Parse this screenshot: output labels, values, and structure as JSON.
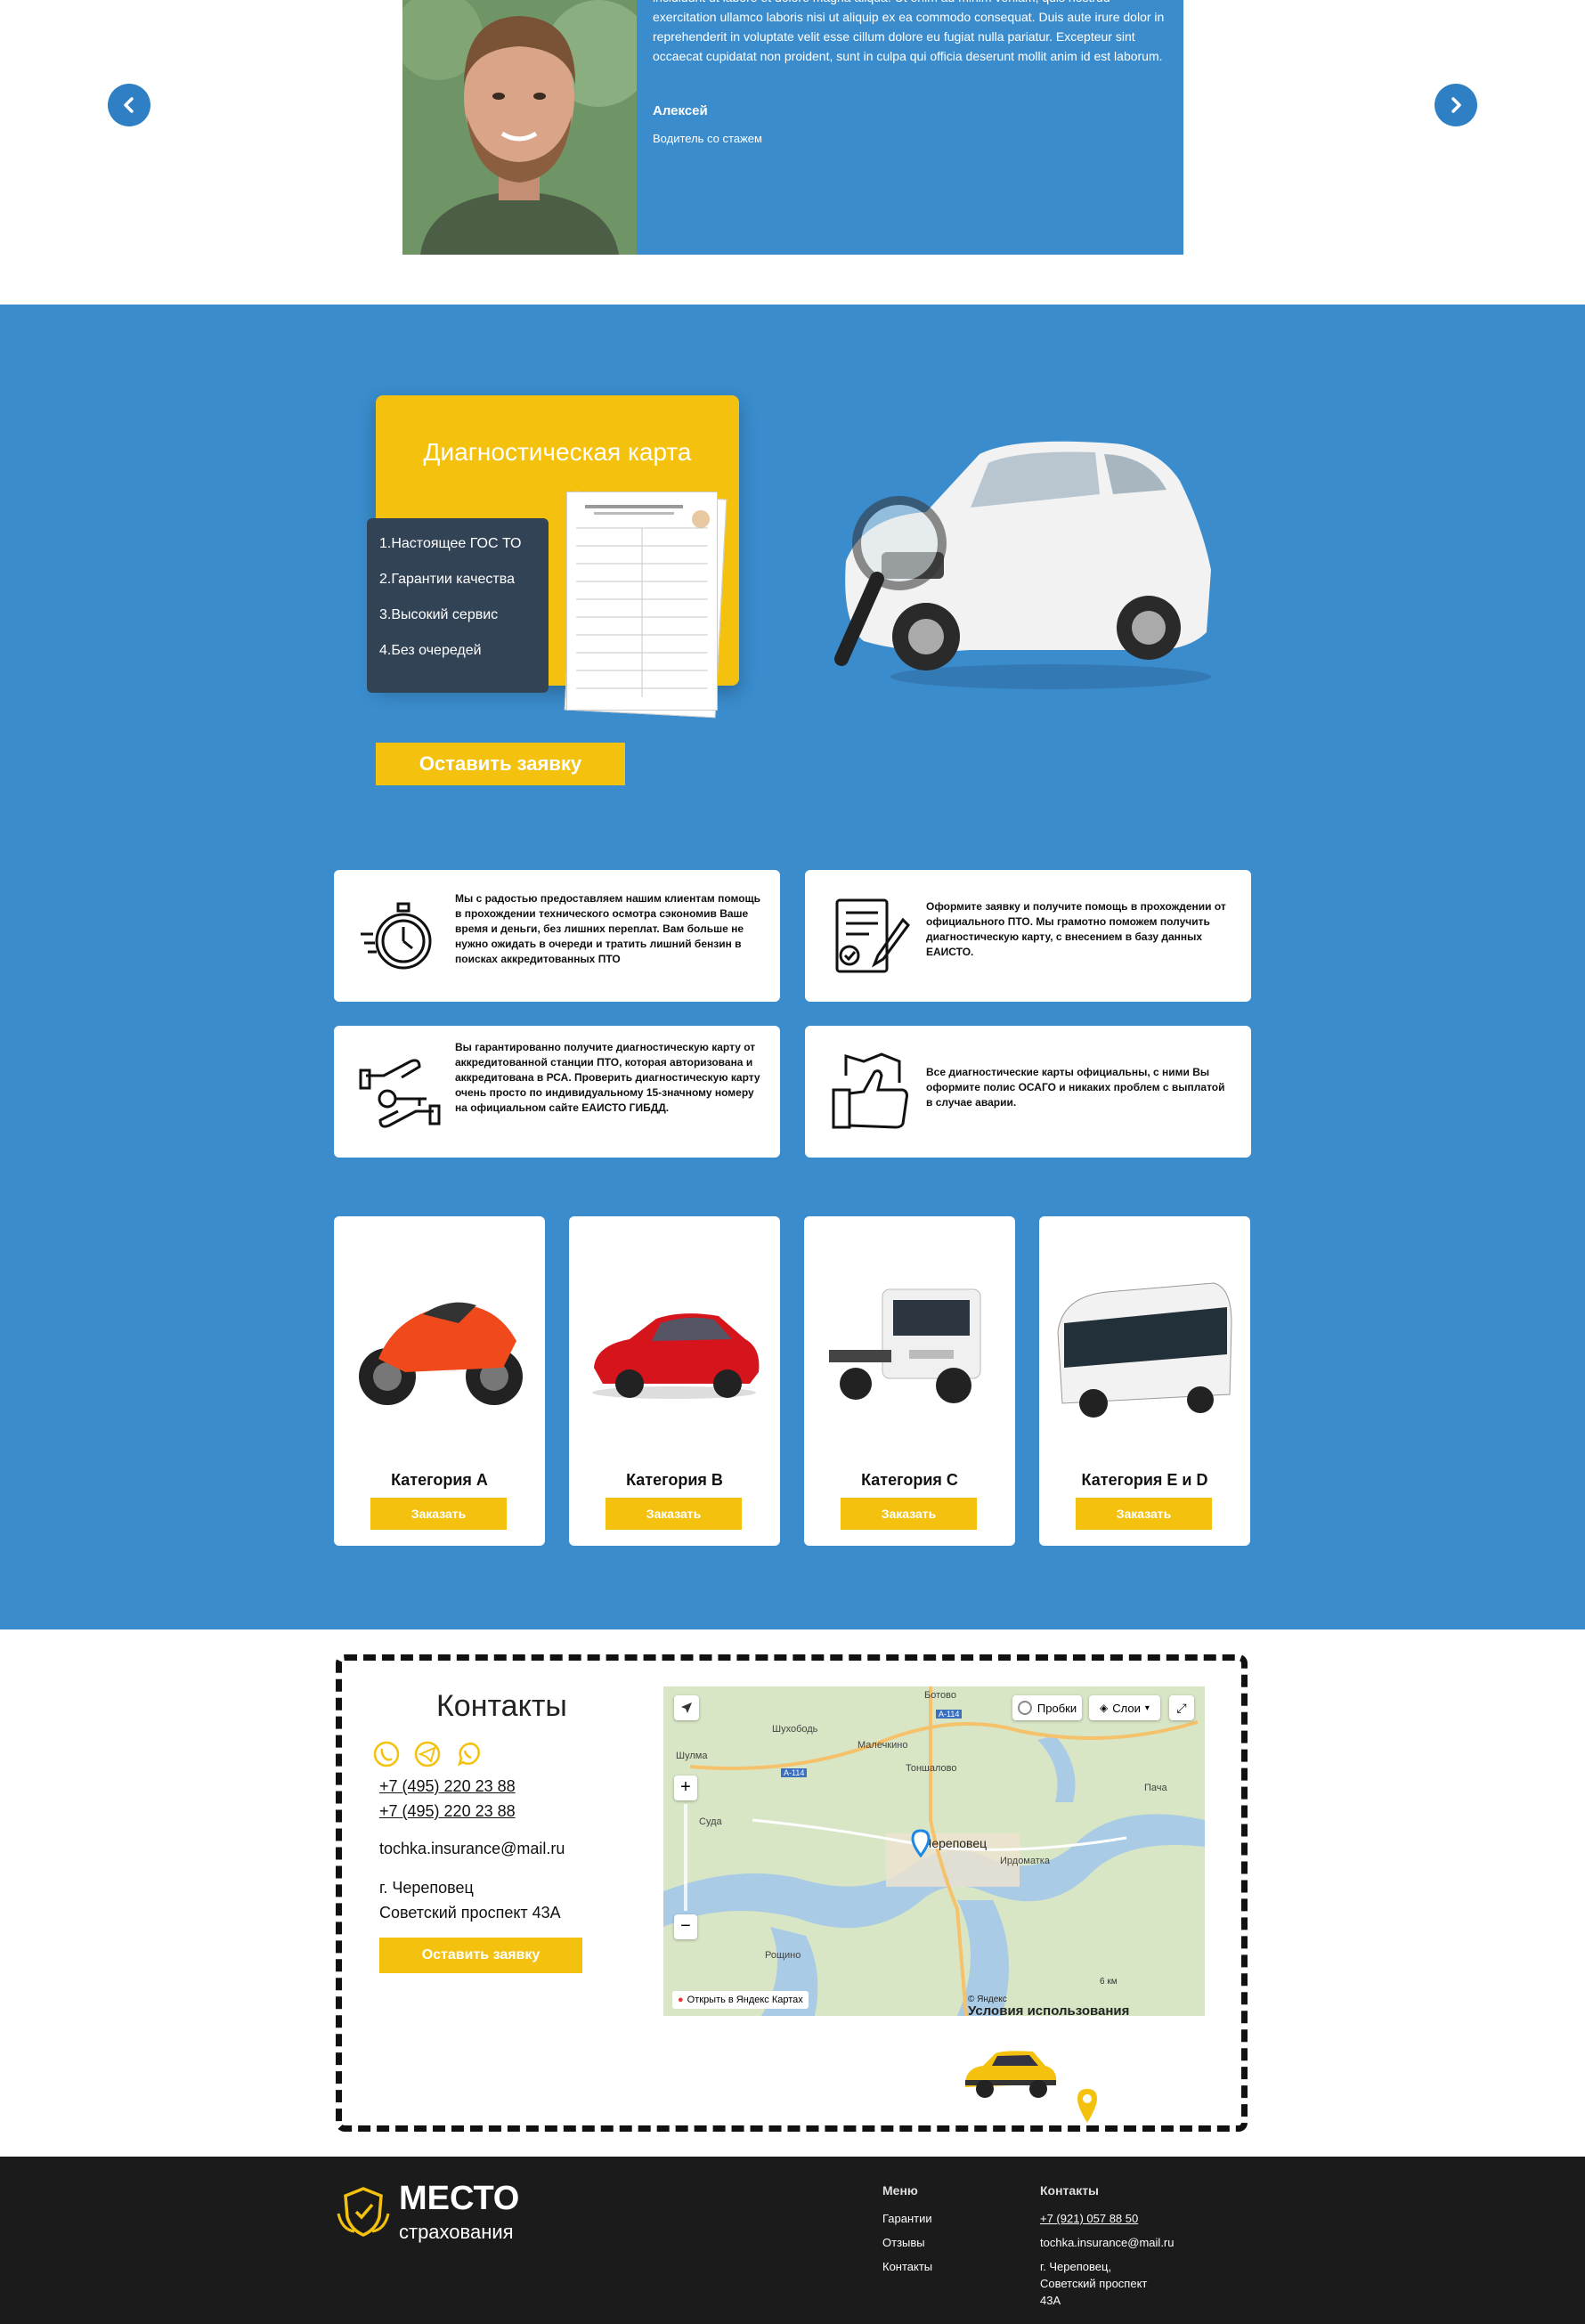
{
  "testimonial": {
    "text": "incididunt ut labore et dolore magna aliqua. Ut enim ad minim veniam, quis nostrud exercitation ullamco laboris nisi ut aliquip ex ea commodo consequat. Duis aute irure dolor in reprehenderit in voluptate velit esse cillum dolore eu fugiat nulla pariatur. Excepteur sint occaecat cupidatat non proident, sunt in culpa qui officia deserunt mollit anim id est laborum.",
    "name": "Алексей",
    "role": "Водитель со стажем"
  },
  "diagnostic": {
    "title": "Диагностическая карта",
    "items": [
      "1.Настоящее ГОС ТО",
      "2.Гарантии качества",
      "3.Высокий сервис",
      "4.Без очередей"
    ],
    "cta": "Оставить заявку"
  },
  "features": [
    {
      "icon": "stopwatch-icon",
      "text": "Мы с радостью предоставляем нашим клиентам помощь в прохождении технического осмотра сэкономив Ваше время и деньги, без лишних переплат. Вам больше не нужно ожидать в очереди и тратить лишний бензин в поисках аккредитованных ПТО"
    },
    {
      "icon": "document-pen-icon",
      "text": "Оформите заявку и получите помощь в прохождении от официального ПТО. Мы грамотно поможем получить диагностическую карту, с внесением в базу данных ЕАИСТО."
    },
    {
      "icon": "hand-key-icon",
      "text": "Вы гарантированно получите диагностическую карту от аккредитованной станции ПТО, которая авторизована и аккредитована в РСА. Проверить диагностическую карту очень просто по индивидуальному 15-значному номеру на официальном сайте ЕАИСТО ГИБДД."
    },
    {
      "icon": "thumbs-up-icon",
      "text": "Все диагностические карты официальны, с ними Вы оформите полис ОСАГО и никаких проблем с выплатой в случае аварии."
    }
  ],
  "categories": [
    {
      "name": "Категория A",
      "order": "Заказать",
      "image": "motorcycle"
    },
    {
      "name": "Категория B",
      "order": "Заказать",
      "image": "car"
    },
    {
      "name": "Категория C",
      "order": "Заказать",
      "image": "truck"
    },
    {
      "name": "Категория E и D",
      "order": "Заказать",
      "image": "bus"
    }
  ],
  "contacts": {
    "title": "Контакты",
    "phone1": "+7 (495) 220 23 88",
    "phone2": "+7 (495) 220 23 88",
    "email": "tochka.insurance@mail.ru",
    "city": "г. Череповец",
    "address": "Советский проспект 43А",
    "cta": "Оставить заявку",
    "messenger_icons": [
      "viber-icon",
      "telegram-icon",
      "whatsapp-icon"
    ]
  },
  "map": {
    "traffic_label": "Пробки",
    "layers_label": "Слои",
    "open_label": "Открыть в Яндекс Картах",
    "copyright": "© Яндекс",
    "terms": "Условия использования",
    "scale": "6 км",
    "places": [
      {
        "name": "Череповец",
        "kind": "city"
      },
      {
        "name": "Ботово",
        "kind": "village"
      },
      {
        "name": "Шухободь",
        "kind": "village"
      },
      {
        "name": "Малечкино",
        "kind": "village"
      },
      {
        "name": "Шулма",
        "kind": "village"
      },
      {
        "name": "Тоншалово",
        "kind": "village"
      },
      {
        "name": "Суда",
        "kind": "village"
      },
      {
        "name": "Ирдоматка",
        "kind": "village"
      },
      {
        "name": "Рощино",
        "kind": "village"
      },
      {
        "name": "Пача",
        "kind": "village"
      }
    ],
    "roads": [
      "А-114",
      "А-114"
    ]
  },
  "footer": {
    "logo_main": "МЕСТО",
    "logo_sub": "страхования",
    "menu_title": "Меню",
    "menu_items": [
      "Гарантии",
      "Отзывы",
      "Контакты"
    ],
    "contacts_title": "Контакты",
    "phone": "+7 (921) 057 88 50",
    "email": "tochka.insurance@mail.ru",
    "address_lines": [
      "г. Череповец,",
      "Советский проспект",
      "43А"
    ]
  },
  "colors": {
    "blue": "#3a8ccd",
    "yellow": "#f4c20e",
    "dark": "#334356",
    "footer": "#1b1b1b"
  }
}
